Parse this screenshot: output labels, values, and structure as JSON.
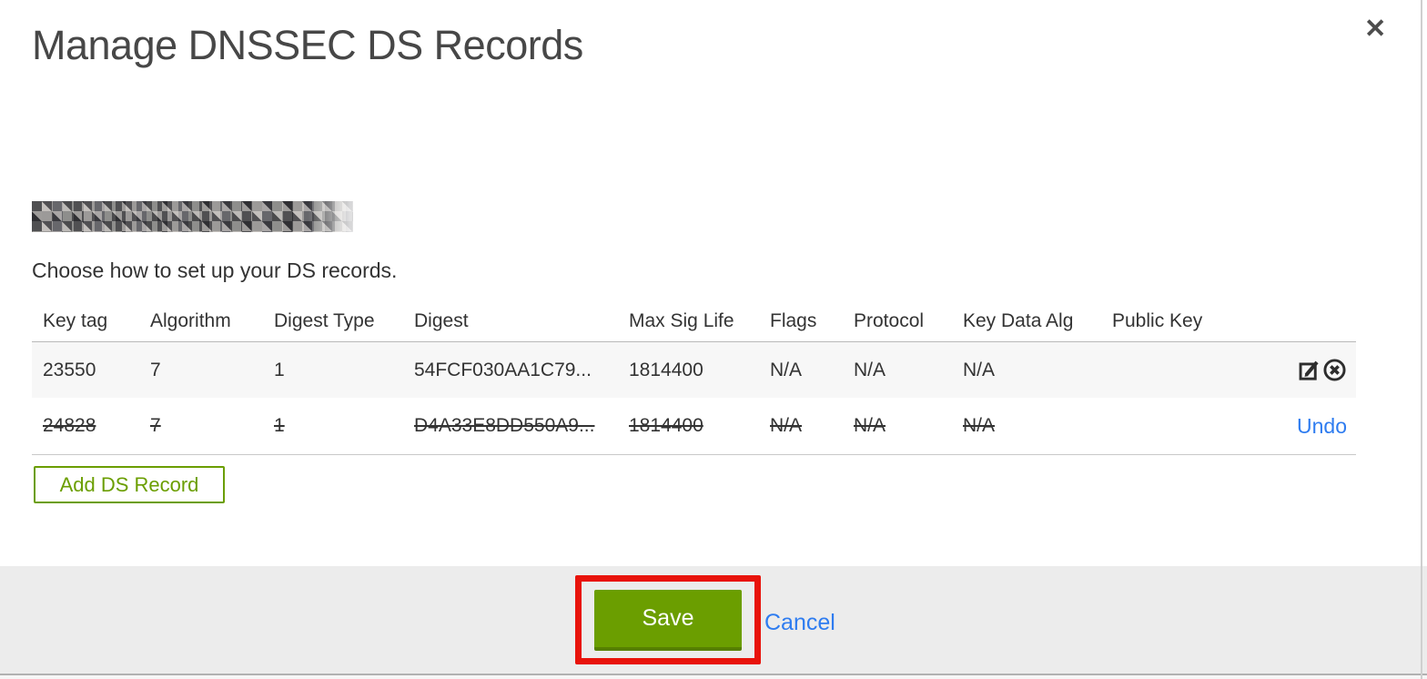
{
  "colors": {
    "green": "#6b9e00",
    "green_dark": "#567f00",
    "blue": "#2e7cf0",
    "red": "#e8130b"
  },
  "dialog": {
    "title": "Manage DNSSEC DS Records",
    "close": "✕",
    "domain_redacted": true,
    "subtitle": "Choose how to set up your DS records.",
    "table": {
      "headers": [
        "Key tag",
        "Algorithm",
        "Digest Type",
        "Digest",
        "Max Sig Life",
        "Flags",
        "Protocol",
        "Key Data Alg",
        "Public Key"
      ],
      "rows": [
        {
          "cells": [
            "23550",
            "7",
            "1",
            "54FCF030AA1C79...",
            "1814400",
            "N/A",
            "N/A",
            "N/A",
            ""
          ],
          "deleted": false
        },
        {
          "cells": [
            "24828",
            "7",
            "1",
            "D4A33E8DD550A9...",
            "1814400",
            "N/A",
            "N/A",
            "N/A",
            ""
          ],
          "deleted": true,
          "undo_label": "Undo"
        }
      ]
    },
    "add_ds_record_label": "Add DS Record",
    "footer": {
      "save_label": "Save",
      "cancel_label": "Cancel"
    }
  }
}
